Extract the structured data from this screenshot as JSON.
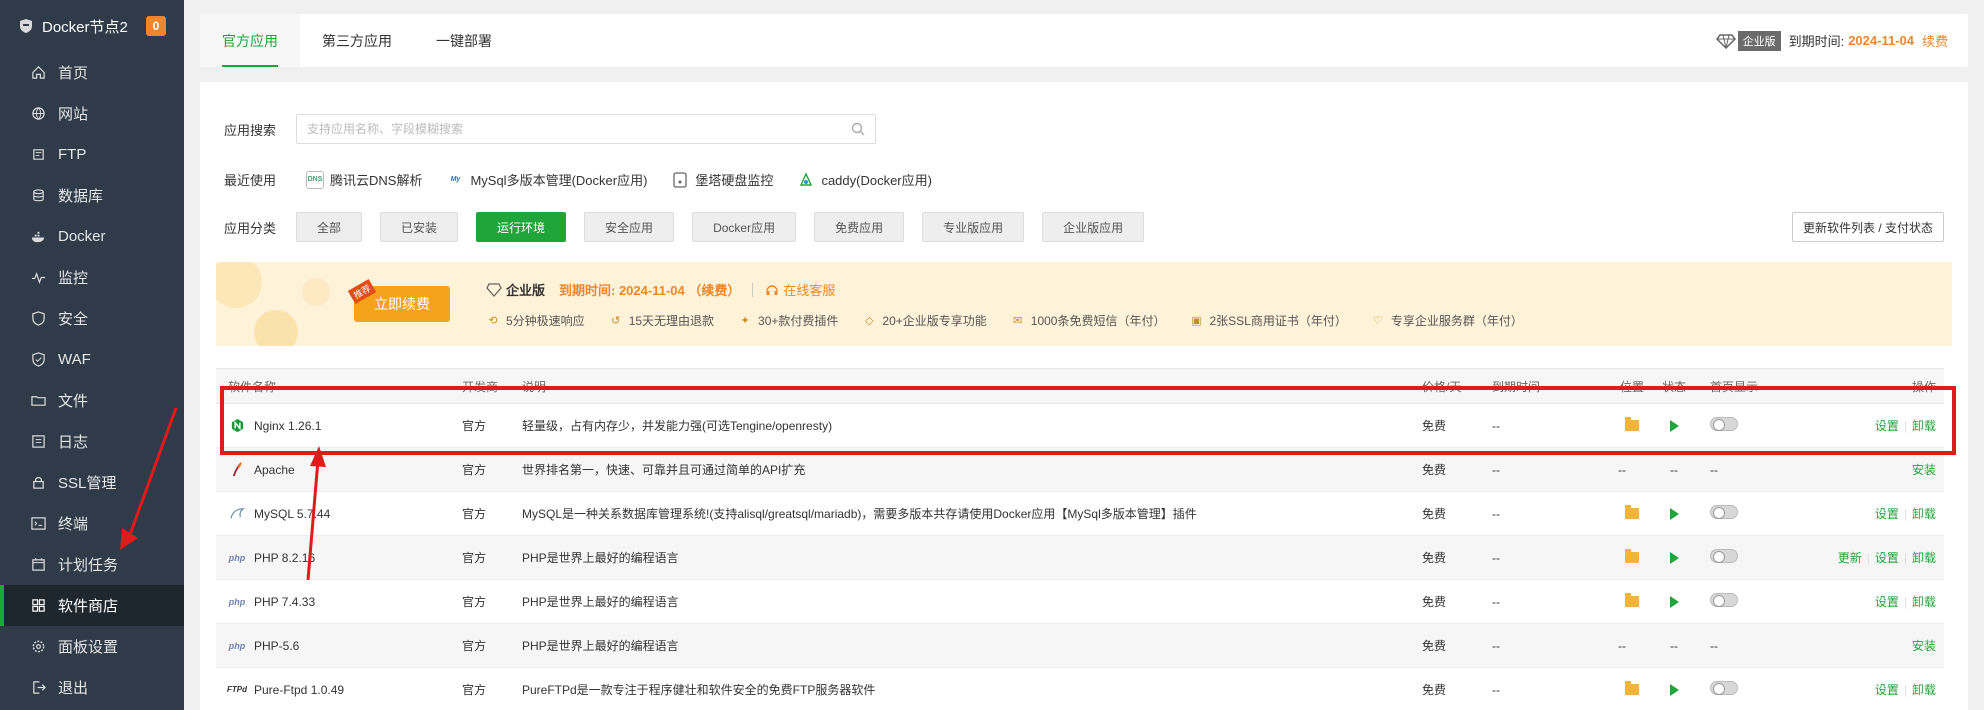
{
  "sidebar": {
    "title": "Docker节点2",
    "badge": "0",
    "items": [
      {
        "label": "首页",
        "icon": "home-icon"
      },
      {
        "label": "网站",
        "icon": "globe-icon"
      },
      {
        "label": "FTP",
        "icon": "ftp-icon"
      },
      {
        "label": "数据库",
        "icon": "database-icon"
      },
      {
        "label": "Docker",
        "icon": "docker-icon"
      },
      {
        "label": "监控",
        "icon": "monitor-icon"
      },
      {
        "label": "安全",
        "icon": "shield-icon"
      },
      {
        "label": "WAF",
        "icon": "waf-icon"
      },
      {
        "label": "文件",
        "icon": "folder-icon"
      },
      {
        "label": "日志",
        "icon": "log-icon"
      },
      {
        "label": "SSL管理",
        "icon": "ssl-icon"
      },
      {
        "label": "终端",
        "icon": "terminal-icon"
      },
      {
        "label": "计划任务",
        "icon": "calendar-icon"
      },
      {
        "label": "软件商店",
        "icon": "grid-icon"
      },
      {
        "label": "面板设置",
        "icon": "gear-icon"
      },
      {
        "label": "退出",
        "icon": "logout-icon"
      }
    ],
    "active_index": 13
  },
  "tabs": [
    "官方应用",
    "第三方应用",
    "一键部署"
  ],
  "header": {
    "edition_tag": "企业版",
    "expire_label": "到期时间:",
    "expire_date": "2024-11-04",
    "renew": "续费"
  },
  "search": {
    "label": "应用搜索",
    "placeholder": "支持应用名称、字段模糊搜索"
  },
  "recent": {
    "label": "最近使用",
    "items": [
      {
        "label": "腾讯云DNS解析",
        "icon": "dnspod-icon"
      },
      {
        "label": "MySql多版本管理(Docker应用)",
        "icon": "mysql-icon"
      },
      {
        "label": "堡塔硬盘监控",
        "icon": "disk-icon"
      },
      {
        "label": "caddy(Docker应用)",
        "icon": "caddy-icon"
      }
    ]
  },
  "categories": {
    "label": "应用分类",
    "items": [
      "全部",
      "已安装",
      "运行环境",
      "安全应用",
      "Docker应用",
      "免费应用",
      "专业版应用",
      "企业版应用"
    ],
    "active_index": 2,
    "refresh": "更新软件列表 / 支付状态"
  },
  "banner": {
    "ribbon": "推荐",
    "renew_button": "立即续费",
    "edition": "企业版",
    "expire_text": "到期时间: 2024-11-04 （续费）",
    "service": "在线客服",
    "features": [
      "5分钟极速响应",
      "15天无理由退款",
      "30+款付费插件",
      "20+企业版专享功能",
      "1000条免费短信（年付）",
      "2张SSL商用证书（年付）",
      "专享企业服务群（年付）"
    ]
  },
  "table": {
    "headers": [
      "软件名称",
      "开发商",
      "说明",
      "价格/天",
      "到期时间",
      "位置",
      "状态",
      "首页显示",
      "操作"
    ],
    "rows": [
      {
        "name": "Nginx 1.26.1",
        "icon": "nginx-icon",
        "dev": "官方",
        "desc": "轻量级，占有内存少，并发能力强(可选Tengine/openresty)",
        "price": "免费",
        "expire": "--",
        "installed": true,
        "ops": [
          "设置",
          "卸载"
        ]
      },
      {
        "name": "Apache",
        "icon": "apache-icon",
        "dev": "官方",
        "desc": "世界排名第一，快速、可靠并且可通过简单的API扩充",
        "price": "免费",
        "expire": "--",
        "installed": false,
        "loc": "--",
        "stat": "--",
        "home": "--",
        "ops": [
          "安装"
        ]
      },
      {
        "name": "MySQL 5.7.44",
        "icon": "mysql-icon",
        "dev": "官方",
        "desc": "MySQL是一种关系数据库管理系统!(支持alisql/greatsql/mariadb)，需要多版本共存请使用Docker应用【MySql多版本管理】插件",
        "price": "免费",
        "expire": "--",
        "installed": true,
        "ops": [
          "设置",
          "卸载"
        ]
      },
      {
        "name": "PHP 8.2.16",
        "icon": "php-icon",
        "dev": "官方",
        "desc": "PHP是世界上最好的编程语言",
        "price": "免费",
        "expire": "--",
        "installed": true,
        "ops": [
          "更新",
          "设置",
          "卸载"
        ]
      },
      {
        "name": "PHP 7.4.33",
        "icon": "php-icon",
        "dev": "官方",
        "desc": "PHP是世界上最好的编程语言",
        "price": "免费",
        "expire": "--",
        "installed": true,
        "ops": [
          "设置",
          "卸载"
        ]
      },
      {
        "name": "PHP-5.6",
        "icon": "php-icon",
        "dev": "官方",
        "desc": "PHP是世界上最好的编程语言",
        "price": "免费",
        "expire": "--",
        "installed": false,
        "loc": "--",
        "stat": "--",
        "home": "--",
        "ops": [
          "安装"
        ]
      },
      {
        "name": "Pure-Ftpd 1.0.49",
        "icon": "ftp-icon",
        "dev": "官方",
        "desc": "PureFTPd是一款专注于程序健壮和软件安全的免费FTP服务器软件",
        "price": "免费",
        "expire": "--",
        "installed": true,
        "ops": [
          "设置",
          "卸载"
        ]
      }
    ]
  },
  "colors": {
    "accent": "#20a53a",
    "orange": "#f0862b",
    "sidebar_bg": "#2f3b48",
    "annotation_red": "#e01b1b"
  }
}
